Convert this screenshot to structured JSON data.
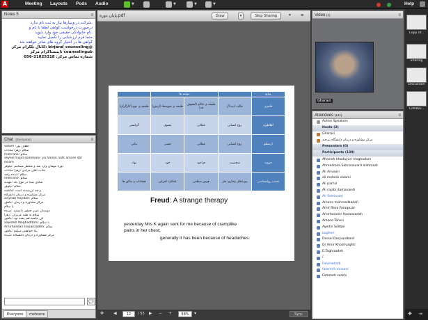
{
  "topbar": {
    "logo": "A",
    "menus": [
      "Meeting",
      "Layouts",
      "Pods",
      "Audio"
    ],
    "help": "Help",
    "colors": {
      "mic_active": "#5fbf2a",
      "status_red": "#d83a2a",
      "status_green": "#3aa34a"
    }
  },
  "notes": {
    "title": "Notes 5",
    "lines": [
      ".شرکت در وبینارها نیاز به ثبت نام ندارد",
      "درصورت درخواست گواهی لطفا با نام و",
      ".نام خانوادگی حقیقی خود وارد شوید",
      "",
      "حتما فرم ارزشیابی را تکمیل نمایید",
      "گواهی ها در اختیار گروه های صادر خواهند شد",
      "@birjand_counseling :کانال تلگرام مرکز",
      "counselingub :اینستاگرام مرکز",
      "شماره تماس مرکز: 31025318-056"
    ]
  },
  "chat": {
    "title": "Chat",
    "scope": "(Everyone)",
    "messages": [
      "Salam :دهقان پور",
      "سلام :زهرا سادات",
      "mehrane: سلام",
      "seyed majid soleimani: ya hanan nafs amare dar",
      "eslam",
      "دوره مهمان وارد شد و منتظر میمانیم :نیلوفر",
      "جناب اقای مرادی :زهرا سادات",
      "سلام :سیده رقیه",
      "mehrane: سلام",
      "شادی صدا در موج بله :مهدیه",
      "سلام :نیلوفر",
      "و چه ارزشمند است :فاطمه",
      "مرکز مشاوره و درمان دانشگاه",
      "Zeynab heydari: سلام",
      "مرکز مشاوره و درمان :ماهور",
      "با سلام",
      "دوستان عزیز چطور دانستید :سیده",
      "سلام به همه عزیزان :زهرا",
      "این جلسه هم مفید بود :ماهور",
      "Sajedeh Moghaddam: با سلام",
      "Amirhosean Hasanzadeh: سلام",
      "بله خواهش میکنم :ماهور",
      "مرکز مشاوره و درمان دانشگاه :سیده"
    ],
    "tabs": [
      "Everyone",
      "mehrane"
    ]
  },
  "share": {
    "filename": "پایان دوره.pdf",
    "draw_label": "Draw",
    "stop_label": "Stop Sharing",
    "table": {
      "header": [
        "منابع",
        "",
        "مولفه ها",
        ""
      ],
      "rows": [
        [
          "فانتزی",
          "حالت ایده آل",
          "طبیعه ی حاکم (ایشوف فد)",
          "طبیعه ی متوسط (ارتش)",
          "طبیعه ی دوم (کارگران)"
        ],
        [
          "افلاطون",
          "روح انسانی",
          "عقلانی",
          "معنوی",
          "گرایشی"
        ],
        [
          "ارسطو",
          "روح انسانی",
          "عقلانی",
          "حسی",
          "نباتی"
        ],
        [
          "فروید",
          "شخصیت",
          "فراخود",
          "خود",
          "نهاد"
        ],
        [
          "عصب روانشناسی",
          "پیوندهای رفتاری مغز",
          "هوش منطقی",
          "عملکرد اجرایی",
          "هیجانات و سائق ها"
        ]
      ]
    },
    "slide_title_bold": "Freud",
    "slide_title_rest": ": A strange therapy",
    "quote_line1": "yesterday Mrs K again sent for me because of cramplike",
    "quote_line2": "pains in her chest;",
    "quote_line3": "generally it has been because of headaches.",
    "page_current": "12",
    "page_total": "/ 55",
    "zoom": "58%",
    "sync": "Sync"
  },
  "video": {
    "title": "Video",
    "count": "(1)",
    "presenter": "Gharavi"
  },
  "attendees": {
    "title": "Attendees",
    "count": "(141)",
    "active_speakers": "Active Speakers",
    "hosts_label": "Hosts (2)",
    "hosts": [
      "Gharavi",
      "مرکز مشاوره و درمان دانشگاه بیرجند"
    ],
    "presenters_label": "Presenters (0)",
    "participants_label": "Participants (139)",
    "participants": [
      "Afsaneh khodayari moghadam",
      "Ahmadreza Sahranavard alahmadi",
      "Ali Anvaari",
      "ali mehrali salami",
      "Ali parhiz",
      "Ali rajabi damavandi",
      "Ali Soleimani",
      "Amene mahmodzadeh",
      "Amir Reza Faragozar",
      "Amirhossein Hasanzadeh",
      "Arezoo Taheri",
      "Ayedin Soltani",
      "bagheri",
      "Danial Daryanabard",
      "Dr Amir Khoshvaghti",
      "E.Taghizadeh",
      "F",
      "Fahimehadi",
      "fatemeh mirzaei",
      "Fatemeh sorkhi"
    ],
    "link_indices": [
      6,
      12,
      16,
      17,
      18
    ]
  },
  "sidebar": {
    "items": [
      "Copy of...",
      "Sharing",
      "Discussion",
      "Collabo..."
    ]
  }
}
